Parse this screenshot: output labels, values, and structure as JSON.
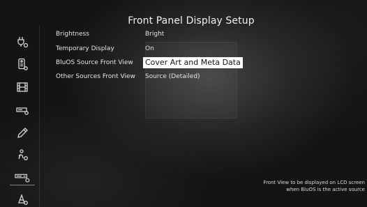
{
  "page": {
    "title": "Front Panel Display Setup"
  },
  "sidebar": {
    "items": [
      {
        "icon": "audio-plug-icon",
        "active": false
      },
      {
        "icon": "remote-icon",
        "active": false
      },
      {
        "icon": "film-icon",
        "active": false
      },
      {
        "icon": "display-unit-icon",
        "active": false
      },
      {
        "icon": "pencil-icon",
        "active": false
      },
      {
        "icon": "person-gear-icon",
        "active": false
      },
      {
        "icon": "device-settings-icon",
        "active": true
      },
      {
        "icon": "speaker-gear-icon",
        "active": false
      }
    ]
  },
  "settings": {
    "rows": [
      {
        "label": "Brightness",
        "value": "Bright",
        "selected": false
      },
      {
        "label": "Temporary Display",
        "value": "On",
        "selected": false
      },
      {
        "label": "BluOS Source Front View",
        "value": "Cover Art and Meta Data",
        "selected": true
      },
      {
        "label": "Other Sources Front View",
        "value": "Source (Detailed)",
        "selected": false
      }
    ]
  },
  "help": {
    "line1": "Front View to be displayed on LCD screen",
    "line2": "when BluOS is the active source"
  },
  "colors": {
    "background": "#141414",
    "highlight": "#ffffff",
    "text": "#e8e8e8"
  }
}
